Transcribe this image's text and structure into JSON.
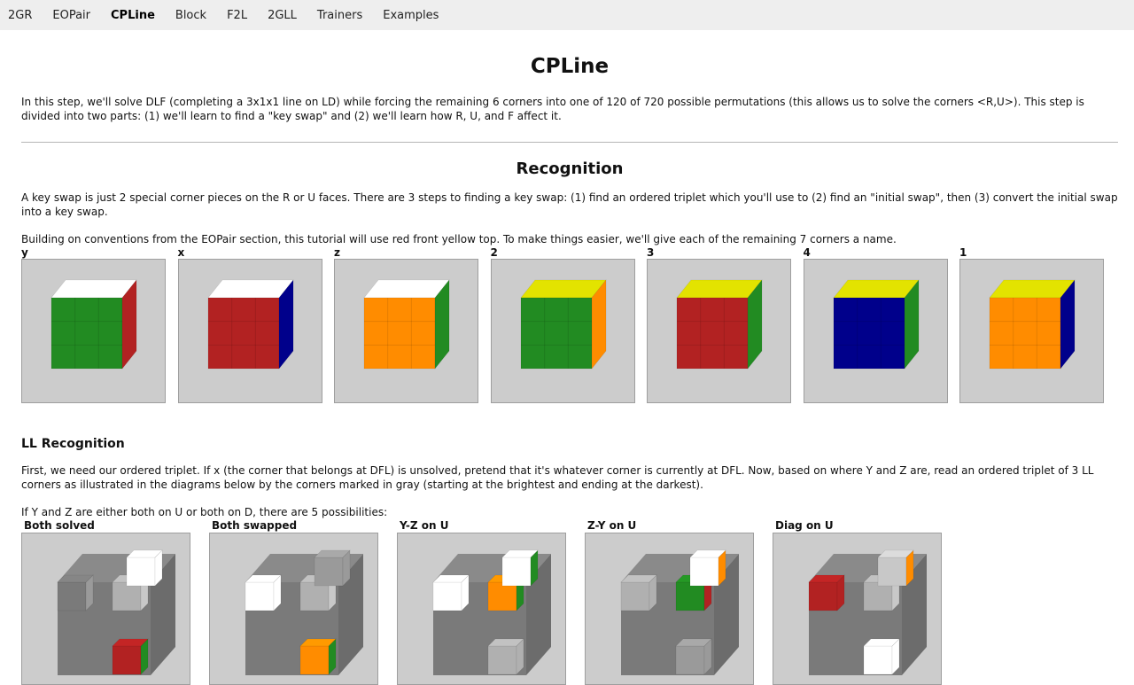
{
  "nav": {
    "items": [
      "2GR",
      "EOPair",
      "CPLine",
      "Block",
      "F2L",
      "2GLL",
      "Trainers",
      "Examples"
    ],
    "active": "CPLine"
  },
  "page": {
    "title": "CPLine",
    "intro": "In this step, we'll solve DLF (completing a 3x1x1 line on LD) while forcing the remaining 6 corners into one of 120 of 720 possible permutations (this allows us to solve the corners <R,U>). This step is divided into two parts: (1) we'll learn to find a \"key swap\" and (2) we'll learn how R, U, and F affect it."
  },
  "recognition": {
    "heading": "Recognition",
    "key_swap_text": "A key swap is just 2 special corner pieces on the R or U faces. There are 3 steps to finding a key swap: (1) find an ordered triplet which you'll use to (2) find an \"initial swap\", then (3) convert the initial swap into a key swap.",
    "building_text": "Building on conventions from the EOPair section, this tutorial will use red front yellow top. To make things easier, we'll give each of the remaining 7 corners a name.",
    "corners": [
      {
        "label": "y",
        "top": "#ffffff",
        "front": "#228b22",
        "right": "#b22222"
      },
      {
        "label": "x",
        "top": "#ffffff",
        "front": "#b22222",
        "right": "#00008b"
      },
      {
        "label": "z",
        "top": "#ffffff",
        "front": "#ff8c00",
        "right": "#228b22"
      },
      {
        "label": "2",
        "top": "#e3e300",
        "front": "#228b22",
        "right": "#ff8c00"
      },
      {
        "label": "3",
        "top": "#e3e300",
        "front": "#b22222",
        "right": "#228b22"
      },
      {
        "label": "4",
        "top": "#e3e300",
        "front": "#00008b",
        "right": "#228b22"
      },
      {
        "label": "1",
        "top": "#e3e300",
        "front": "#ff8c00",
        "right": "#00008b"
      }
    ]
  },
  "ll_recognition": {
    "heading": "LL Recognition",
    "first_text": "First, we need our ordered triplet. If x (the corner that belongs at DFL) is unsolved, pretend that it's whatever corner is currently at DFL. Now, based on where Y and Z are, read an ordered triplet of 3 LL corners as illustrated in the diagrams below by the corners marked in gray (starting at the brightest and ending at the darkest).",
    "if_text": "If Y and Z are either both on U or both on D, there are 5 possibilities:",
    "cases": [
      "Both solved",
      "Both swapped",
      "Y-Z on U",
      "Z-Y on U",
      "Diag on U"
    ]
  },
  "colors": {
    "nav_bg": "#eeeeee",
    "diagram_bg": "#cccccc",
    "cube_gray": "#7a7a7a",
    "white": "#ffffff",
    "yellow": "#e3e300",
    "green": "#228b22",
    "red": "#b22222",
    "blue": "#00008b",
    "orange": "#ff8c00"
  }
}
